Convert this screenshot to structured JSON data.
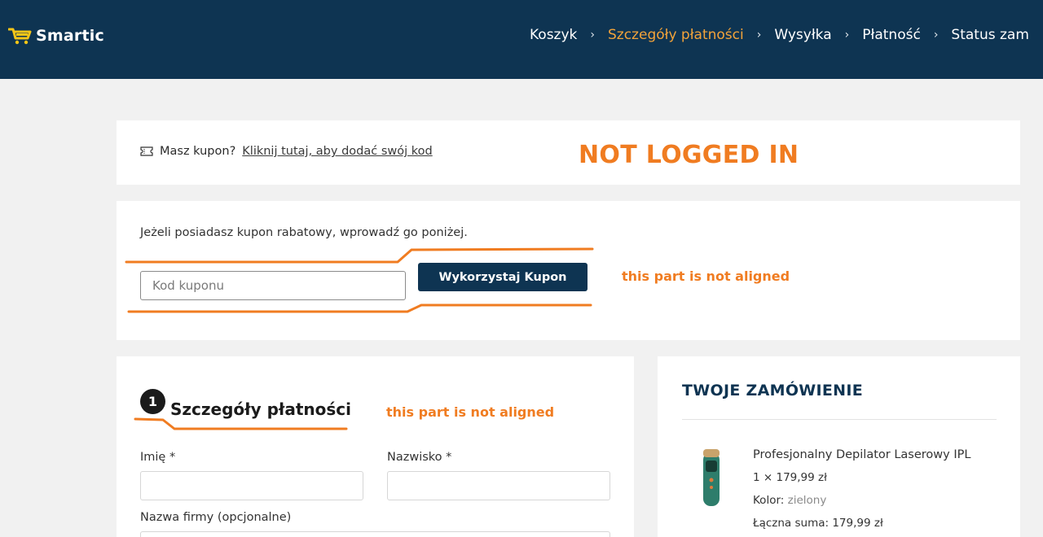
{
  "brand": {
    "name": "Smartic"
  },
  "steps": [
    {
      "label": "Koszyk",
      "active": false
    },
    {
      "label": "Szczegóły płatności",
      "active": true
    },
    {
      "label": "Wysyłka",
      "active": false
    },
    {
      "label": "Płatność",
      "active": false
    },
    {
      "label": "Status zam",
      "active": false
    }
  ],
  "step_separator": "›",
  "coupon_note": {
    "icon": "ticket-icon",
    "prefix": "Masz kupon?",
    "link": "Kliknij tutaj, aby dodać swój kod"
  },
  "coupon_form": {
    "description": "Jeżeli posiadasz kupon rabatowy, wprowadź go poniżej.",
    "placeholder": "Kod kuponu",
    "button": "Wykorzystaj Kupon"
  },
  "annotations": {
    "not_logged_in": "NOT LOGGED IN",
    "coupon_misaligned": "this part is not aligned",
    "billing_misaligned": "this part is not aligned"
  },
  "billing": {
    "step_number": "1",
    "title": "Szczegóły płatności",
    "first_name_label": "Imię *",
    "last_name_label": "Nazwisko *",
    "company_label": "Nazwa firmy (opcjonalne)"
  },
  "order": {
    "title": "TWOJE ZAMÓWIENIE",
    "product_name": "Profesjonalny Depilator Laserowy IPL",
    "quantity_price": "1 × 179,99 zł",
    "color_label": "Kolor:",
    "color_value": "zielony",
    "total": "Łączna suma: 179,99 zł"
  },
  "colors": {
    "header_bg": "#0e3452",
    "accent": "#f2a33a",
    "annotation": "#f07c21",
    "page_bg": "#f1f1f1"
  }
}
